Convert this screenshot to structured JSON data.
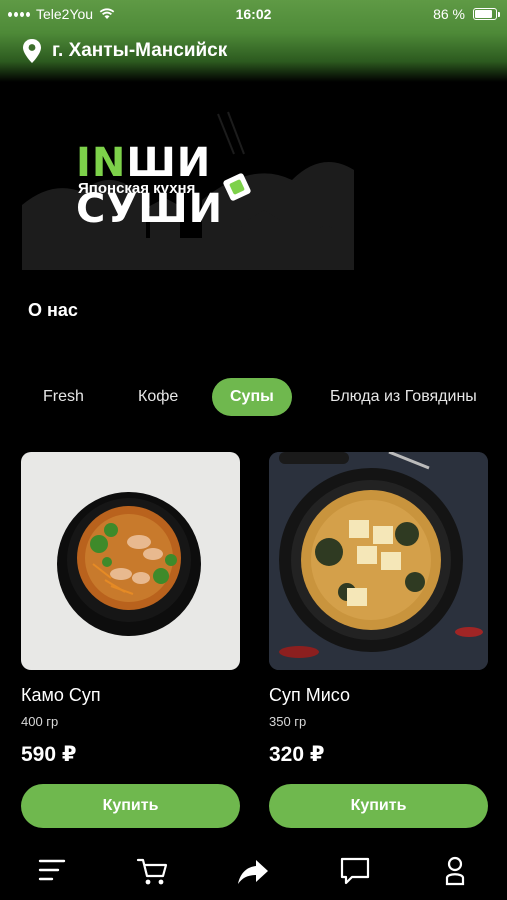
{
  "status_bar": {
    "carrier": "Tele2You",
    "time": "16:02",
    "battery": "86 %",
    "battery_level": 0.86
  },
  "header": {
    "city": "г. Ханты-Мансийск"
  },
  "brand": {
    "logo_in": "IN",
    "logo_rest": "ШИ СУШИ",
    "subtitle": "Японская кухня"
  },
  "about_label": "О нас",
  "categories": [
    {
      "label": "Fresh",
      "active": false
    },
    {
      "label": "Кофе",
      "active": false
    },
    {
      "label": "Супы",
      "active": true
    },
    {
      "label": "Блюда из Говядины",
      "active": false
    }
  ],
  "products": [
    {
      "name": "Камо Суп",
      "weight": "400 гр",
      "price": "590 ₽",
      "buy_label": "Купить"
    },
    {
      "name": "Суп Мисо",
      "weight": "350 гр",
      "price": "320 ₽",
      "buy_label": "Купить"
    }
  ],
  "bottom_nav": [
    "menu-icon",
    "cart-icon",
    "share-icon",
    "chat-icon",
    "profile-icon"
  ],
  "colors": {
    "accent": "#6fb84e",
    "logo_green": "#7dd14a",
    "background": "#000000"
  }
}
